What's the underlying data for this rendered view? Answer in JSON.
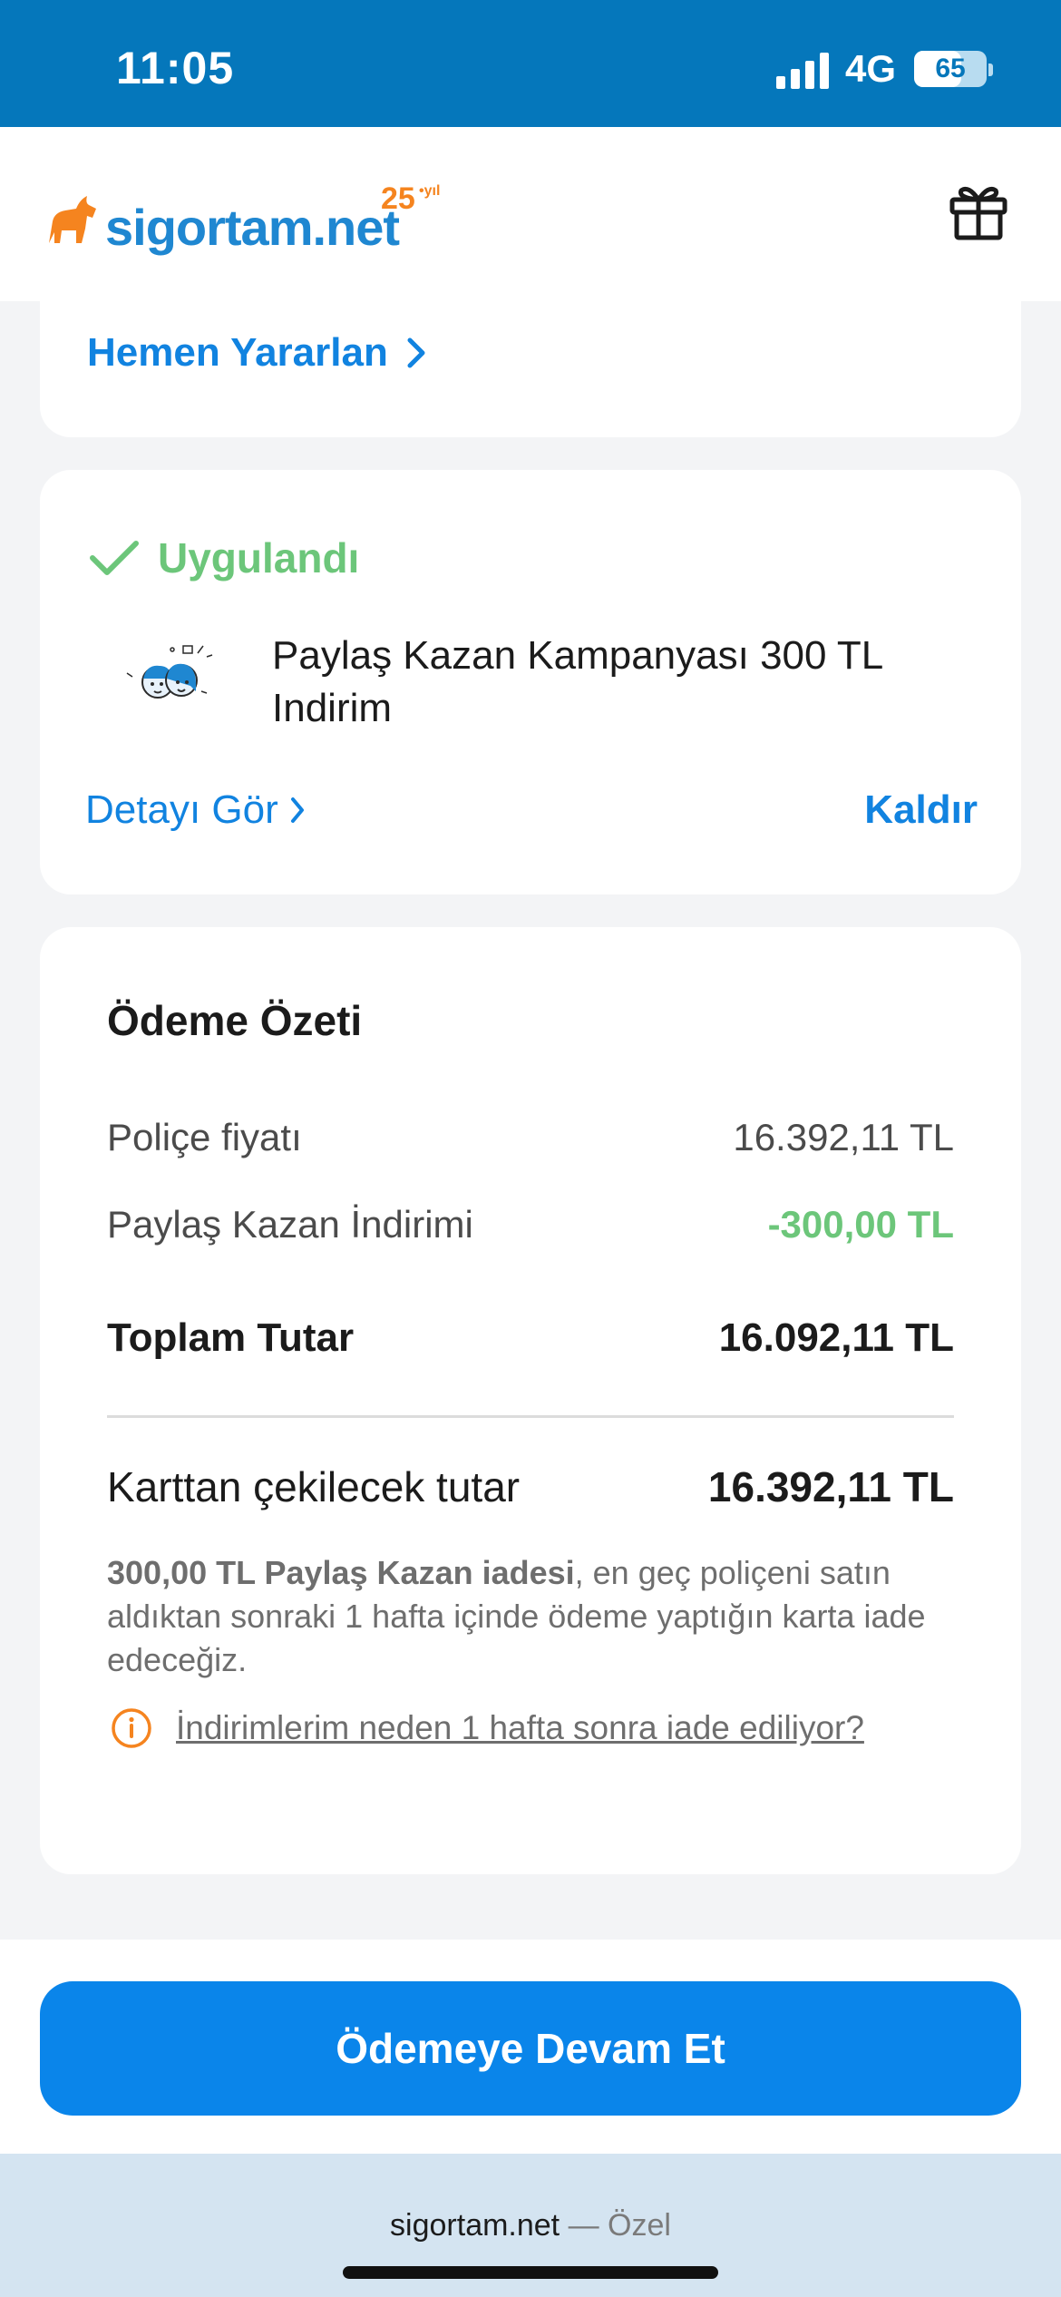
{
  "status_bar": {
    "time": "11:05",
    "network": "4G",
    "battery": "65",
    "battery_level": 0.65
  },
  "header": {
    "logo_text": "sigortam.net",
    "logo_badge": "25",
    "logo_badge_suffix": "•yıl"
  },
  "promo": {
    "cta_label": "Hemen Yararlan"
  },
  "applied_discount": {
    "status": "Uygulandı",
    "title": "Paylaş Kazan Kampanyası 300 TL Indirim",
    "details_label": "Detayı Gör",
    "remove_label": "Kaldır"
  },
  "summary": {
    "title": "Ödeme Özeti",
    "rows": [
      {
        "label": "Poliçe fiyatı",
        "value": "16.392,11 TL"
      },
      {
        "label": "Paylaş Kazan İndirimi",
        "value": "-300,00 TL"
      },
      {
        "label": "Toplam Tutar",
        "value": "16.092,11 TL"
      }
    ],
    "charge": {
      "label": "Karttan çekilecek tutar",
      "value": "16.392,11 TL"
    },
    "refund_note_bold": "300,00 TL Paylaş Kazan iadesi",
    "refund_note_rest": ", en geç poliçeni satın aldıktan sonraki 1 hafta içinde ödeme yaptığın karta iade edeceğiz.",
    "why_link": "İndirimlerim neden 1 hafta sonra iade ediliyor?"
  },
  "cta": {
    "label": "Ödemeye Devam Et"
  },
  "browser": {
    "domain": "sigortam.net",
    "suffix": "— Özel"
  },
  "colors": {
    "brand_blue": "#0a85ea",
    "status_blue": "#0577bb",
    "success_green": "#6cc67a",
    "accent_orange": "#f5841f"
  }
}
